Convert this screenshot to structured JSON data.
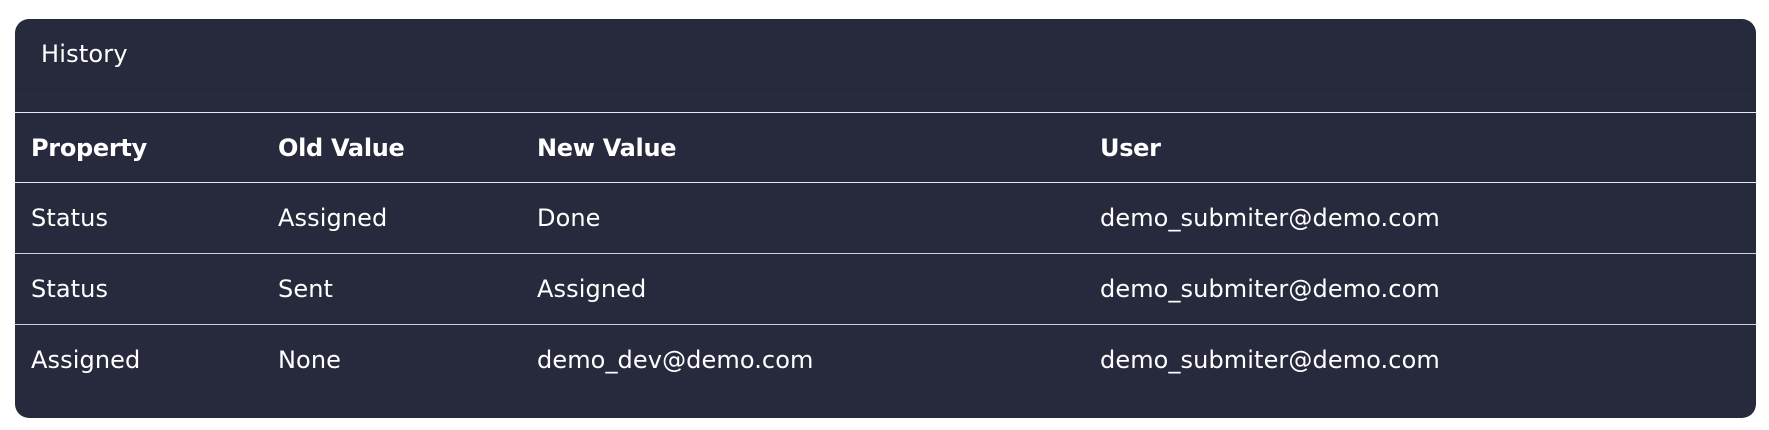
{
  "history": {
    "title": "History",
    "columns": [
      "Property",
      "Old Value",
      "New Value",
      "User"
    ],
    "rows": [
      [
        "Status",
        "Assigned",
        "Done",
        "demo_submiter@demo.com"
      ],
      [
        "Status",
        "Sent",
        "Assigned",
        "demo_submiter@demo.com"
      ],
      [
        "Assigned",
        "None",
        "demo_dev@demo.com",
        "demo_submiter@demo.com"
      ]
    ]
  }
}
